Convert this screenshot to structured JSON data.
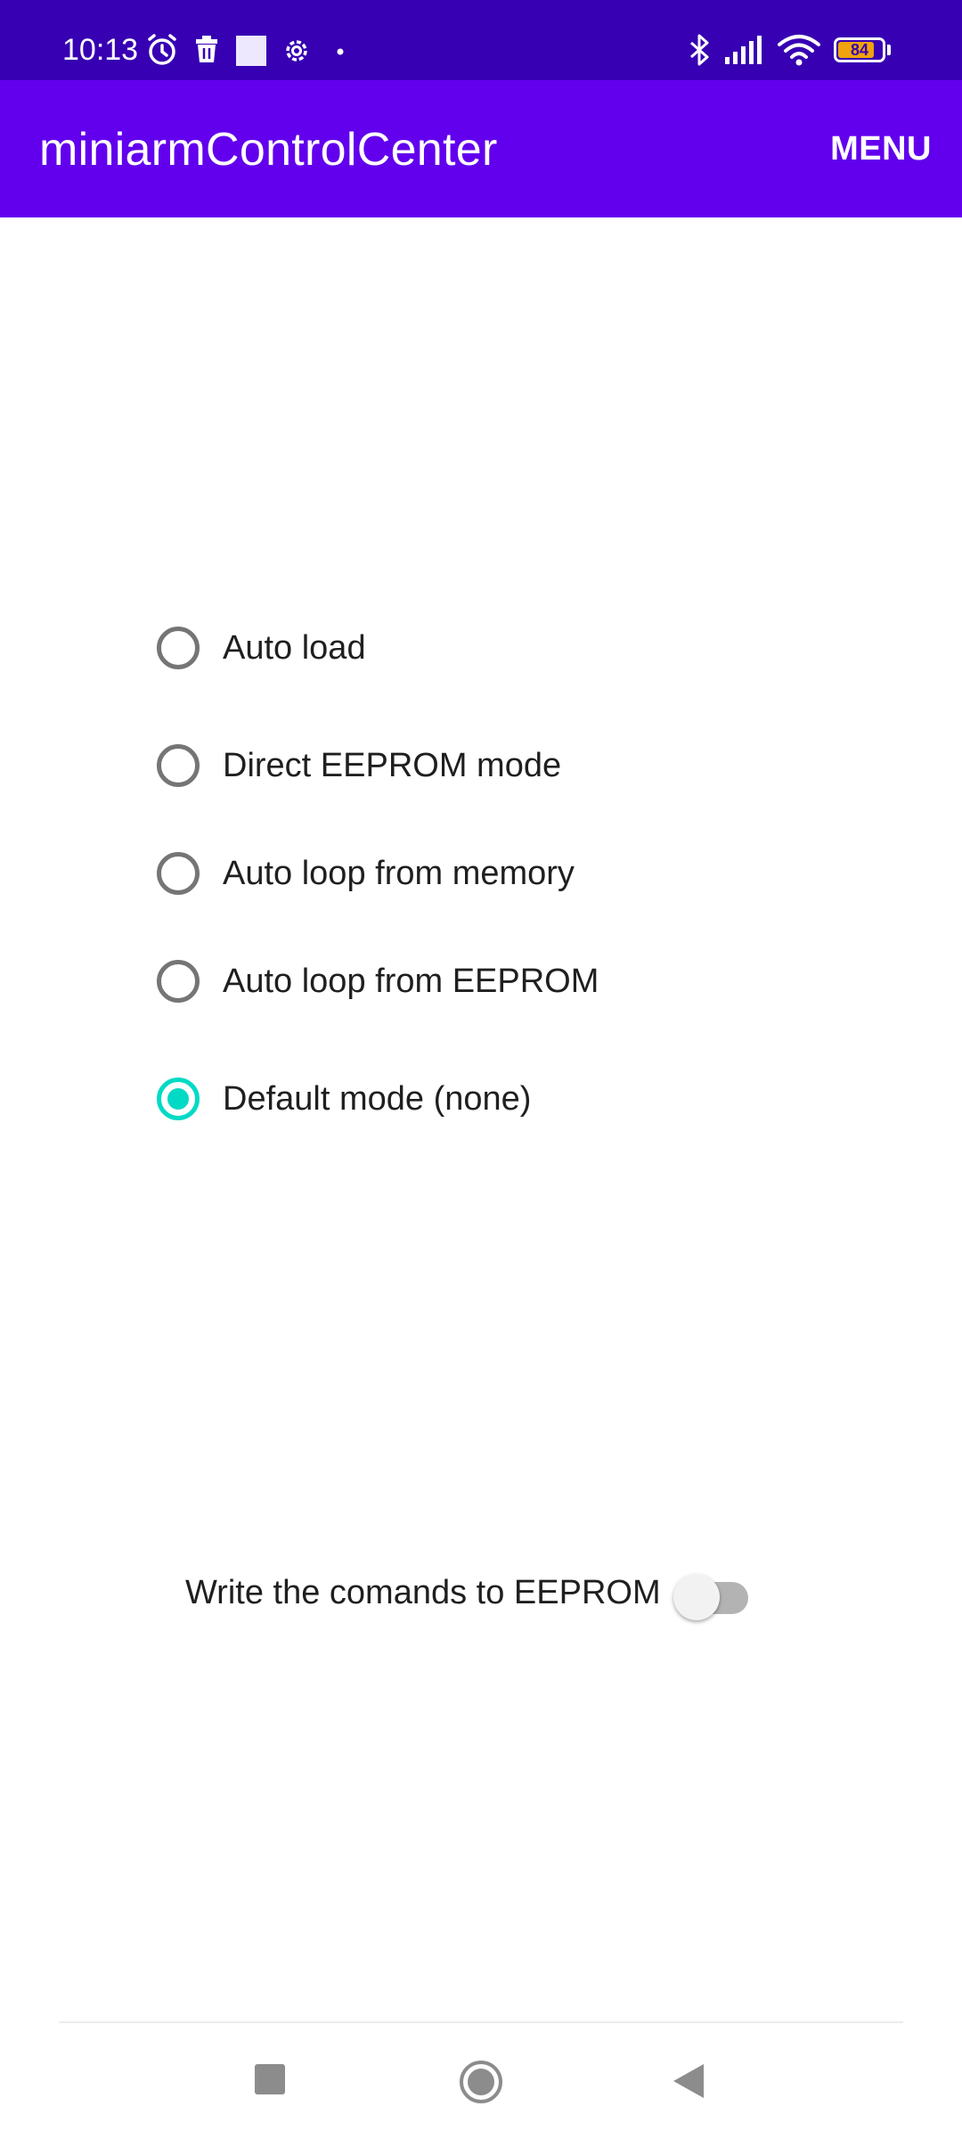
{
  "status_bar": {
    "time": "10:13",
    "battery_level": 84,
    "battery_label": "84",
    "icons": [
      "alarm-icon",
      "trash-icon",
      "square-icon",
      "settings-icon",
      "dot-icon",
      "bluetooth-icon",
      "signal-icon",
      "wifi-icon",
      "battery-icon"
    ]
  },
  "app_bar": {
    "title": "miniarmControlCenter",
    "menu_label": "MENU"
  },
  "radio_group": {
    "options": [
      {
        "label": "Auto load",
        "checked": false
      },
      {
        "label": "Direct EEPROM mode",
        "checked": false
      },
      {
        "label": "Auto loop from memory",
        "checked": false
      },
      {
        "label": "Auto loop from EEPROM",
        "checked": false
      },
      {
        "label": "Default mode (none)",
        "checked": true
      }
    ]
  },
  "eeprom_switch": {
    "label": "Write the comands to EEPROM",
    "on": false
  },
  "nav_bar": {
    "buttons": [
      "recents-icon",
      "home-icon",
      "back-icon"
    ]
  },
  "colors": {
    "status_bar": "#3700b3",
    "app_bar": "#6200ee",
    "radio_accent": "#03dac5",
    "radio_unchecked": "#757575",
    "battery": "#f0a30a"
  }
}
